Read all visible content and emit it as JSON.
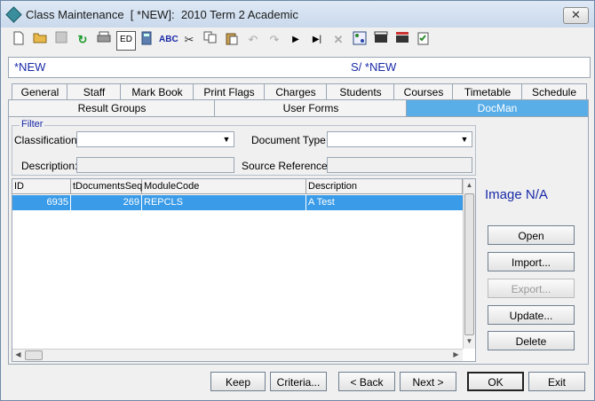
{
  "window": {
    "title": "Class Maintenance  [ *NEW]:  2010 Term 2 Academic"
  },
  "toolbar": {
    "icons": [
      "new-document-icon",
      "open-folder-icon",
      "save-icon",
      "refresh-icon",
      "print-icon",
      "edit-icon",
      "calculator-icon",
      "spellcheck-icon",
      "cut-icon",
      "copy-icon",
      "paste-icon",
      "undo-icon",
      "redo-icon",
      "play-icon",
      "skip-end-icon",
      "delete-icon",
      "network-icon",
      "clapboard-icon",
      "film-icon",
      "checklist-icon"
    ]
  },
  "record": {
    "left": "*NEW",
    "right": "S/ *NEW"
  },
  "tabs_row1": [
    "General",
    "Staff",
    "Mark Book",
    "Print Flags",
    "Charges",
    "Students",
    "Courses",
    "Timetable",
    "Schedule"
  ],
  "tabs_row2": [
    "Result Groups",
    "User Forms",
    "DocMan"
  ],
  "filter": {
    "title": "Filter",
    "classification_label": "Classification:",
    "classification_value": "",
    "doctype_label": "Document Type:",
    "doctype_value": "",
    "description_label": "Description:",
    "description_value": "",
    "source_label": "Source Reference:",
    "source_value": ""
  },
  "grid": {
    "columns": [
      "ID",
      "tDocumentsSeq",
      "ModuleCode",
      "Description"
    ],
    "rows": [
      {
        "id": "6935",
        "seq": "269",
        "module": "REPCLS",
        "desc": "A Test"
      }
    ]
  },
  "image_na": "Image N/A",
  "side_buttons": {
    "open": "Open",
    "import": "Import...",
    "export": "Export...",
    "update": "Update...",
    "delete": "Delete"
  },
  "bottom_buttons": {
    "keep": "Keep",
    "criteria": "Criteria...",
    "back": "< Back",
    "next": "Next >",
    "ok": "OK",
    "exit": "Exit"
  }
}
